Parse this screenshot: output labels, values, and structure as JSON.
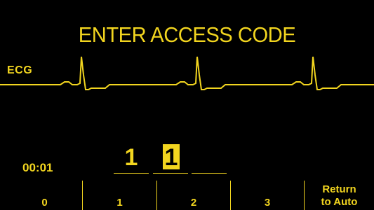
{
  "screen": {
    "title": "ENTER ACCESS CODE",
    "lead_label": "ECG",
    "timer": "00:01",
    "colors": {
      "background": "#000000",
      "accent": "#f2d51f"
    }
  },
  "code_entry": {
    "digits": [
      "1",
      "1",
      ""
    ],
    "active_index": 1
  },
  "softkeys": {
    "key0": "0",
    "key1": "1",
    "key2": "2",
    "key3": "3",
    "return_line1": "Return",
    "return_line2": "to Auto"
  }
}
